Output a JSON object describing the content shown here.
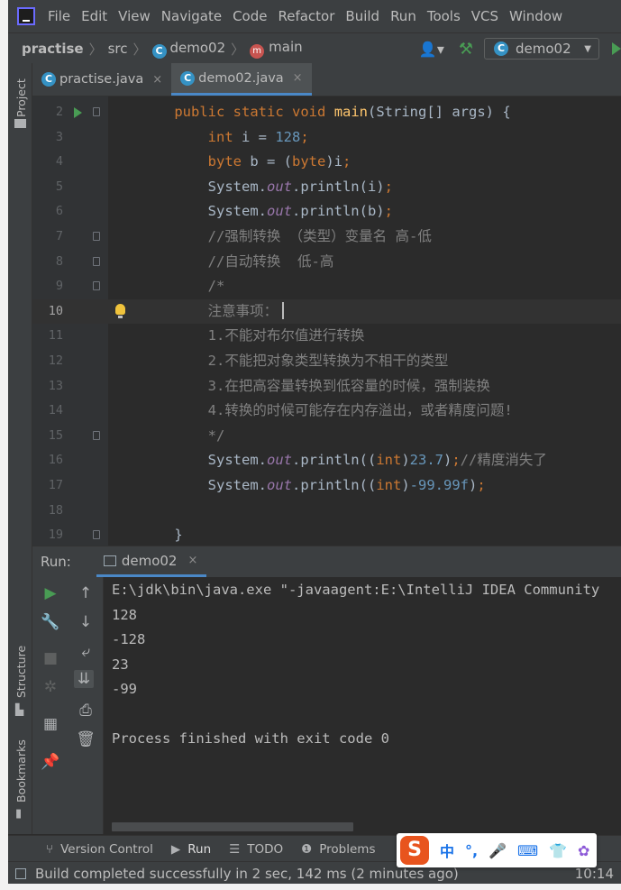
{
  "app": {
    "logo": "intellij-logo"
  },
  "menu": [
    "File",
    "Edit",
    "View",
    "Navigate",
    "Code",
    "Refactor",
    "Build",
    "Run",
    "Tools",
    "VCS",
    "Window"
  ],
  "breadcrumb": {
    "project": "practise",
    "folder": "src",
    "class": "demo02",
    "method": "main"
  },
  "navbar": {
    "run_config": "demo02",
    "class_badge": "C",
    "method_badge": "m"
  },
  "left_tool_windows": {
    "project": "Project",
    "structure": "Structure",
    "bookmarks": "Bookmarks"
  },
  "tabs": [
    {
      "label": "practise.java",
      "close": "×"
    },
    {
      "label": "demo02.java",
      "close": "×"
    }
  ],
  "editor": {
    "current_line": "10",
    "lines": [
      {
        "n": "2",
        "t": "    public static void main(String[] args) {"
      },
      {
        "n": "3",
        "t": "        int i = 128;"
      },
      {
        "n": "4",
        "t": "        byte b = (byte)i;"
      },
      {
        "n": "5",
        "t": "        System.out.println(i);"
      },
      {
        "n": "6",
        "t": "        System.out.println(b);"
      },
      {
        "n": "7",
        "t": "        //强制转换 （类型）变量名 高-低"
      },
      {
        "n": "8",
        "t": "        //自动转换  低-高"
      },
      {
        "n": "9",
        "t": "        /*"
      },
      {
        "n": "10",
        "t": "        注意事项："
      },
      {
        "n": "11",
        "t": "        1.不能对布尔值进行转换"
      },
      {
        "n": "12",
        "t": "        2.不能把对象类型转换为不相干的类型"
      },
      {
        "n": "13",
        "t": "        3.在把高容量转换到低容量的时候，强制装换"
      },
      {
        "n": "14",
        "t": "        4.转换的时候可能存在内存溢出，或者精度问题!"
      },
      {
        "n": "15",
        "t": "        */"
      },
      {
        "n": "16",
        "t": "        System.out.println((int)23.7);//精度消失了"
      },
      {
        "n": "17",
        "t": "        System.out.println((int)-99.99f);"
      },
      {
        "n": "18",
        "t": ""
      },
      {
        "n": "19",
        "t": "    }"
      }
    ]
  },
  "run_panel": {
    "label": "Run:",
    "tab": "demo02",
    "tab_close": "×",
    "console": [
      "E:\\jdk\\bin\\java.exe \"-javaagent:E:\\IntelliJ IDEA Community",
      "128",
      "-128",
      "23",
      "-99",
      "",
      "Process finished with exit code 0"
    ]
  },
  "bottom_tools": [
    "Version Control",
    "Run",
    "TODO",
    "Problems"
  ],
  "status": {
    "message": "Build completed successfully in 2 sec, 142 ms (2 minutes ago)",
    "clock": "10:14"
  },
  "ime": {
    "logo": "S",
    "mode": "中",
    "punct": "°,",
    "items": [
      "mic-icon",
      "keyboard-icon",
      "shirt-icon",
      "apps-icon"
    ]
  },
  "colors": {
    "keyword": "#cc7832",
    "number": "#6897bb",
    "method": "#ffc66d",
    "field": "#9876aa",
    "comment": "#808080",
    "background": "#2b2b2b",
    "panel": "#3c3f41",
    "accent": "#4a88c7"
  }
}
